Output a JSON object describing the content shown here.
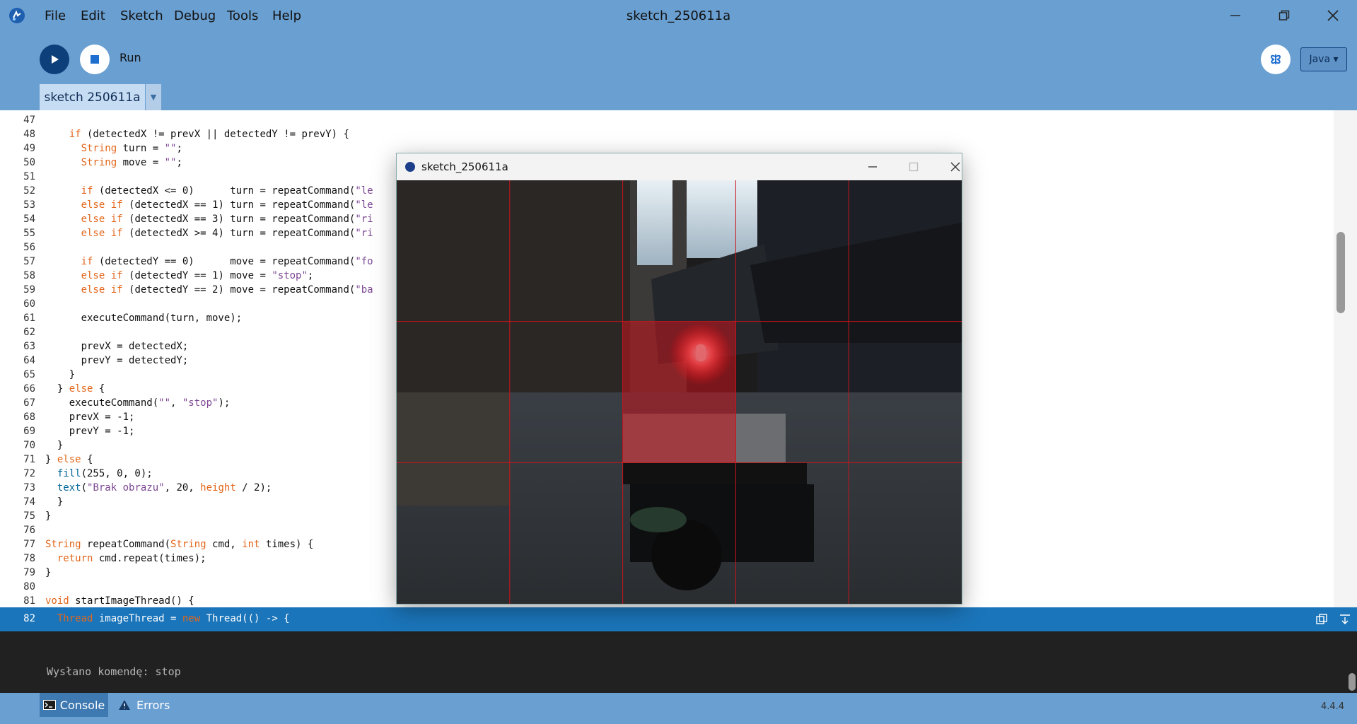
{
  "app": {
    "window_title": "sketch_250611a",
    "menu": [
      "File",
      "Edit",
      "Sketch",
      "Debug",
      "Tools",
      "Help"
    ],
    "run_label": "Run",
    "mode": "Java ▾",
    "tab_name": "sketch 250611a",
    "version": "4.4.4"
  },
  "editor": {
    "lines": [
      {
        "n": "47",
        "html": ""
      },
      {
        "n": "48",
        "html": "    <span class='kw'>if</span> (detectedX != prevX || detectedY != prevY) {"
      },
      {
        "n": "49",
        "html": "      <span class='kw'>String</span> turn = <span class='st'>\"\"</span>;"
      },
      {
        "n": "50",
        "html": "      <span class='kw'>String</span> move = <span class='st'>\"\"</span>;"
      },
      {
        "n": "51",
        "html": ""
      },
      {
        "n": "52",
        "html": "      <span class='kw'>if</span> (detectedX &lt;= 0)      turn = repeatCommand(<span class='st'>\"le</span>"
      },
      {
        "n": "53",
        "html": "      <span class='kw'>else if</span> (detectedX == 1) turn = repeatCommand(<span class='st'>\"le</span>"
      },
      {
        "n": "54",
        "html": "      <span class='kw'>else if</span> (detectedX == 3) turn = repeatCommand(<span class='st'>\"ri</span>"
      },
      {
        "n": "55",
        "html": "      <span class='kw'>else if</span> (detectedX &gt;= 4) turn = repeatCommand(<span class='st'>\"ri</span>"
      },
      {
        "n": "56",
        "html": ""
      },
      {
        "n": "57",
        "html": "      <span class='kw'>if</span> (detectedY == 0)      move = repeatCommand(<span class='st'>\"fo</span>"
      },
      {
        "n": "58",
        "html": "      <span class='kw'>else if</span> (detectedY == 1) move = <span class='st'>\"stop\"</span>;"
      },
      {
        "n": "59",
        "html": "      <span class='kw'>else if</span> (detectedY == 2) move = repeatCommand(<span class='st'>\"ba</span>"
      },
      {
        "n": "60",
        "html": ""
      },
      {
        "n": "61",
        "html": "      executeCommand(turn, move);"
      },
      {
        "n": "62",
        "html": ""
      },
      {
        "n": "63",
        "html": "      prevX = detectedX;"
      },
      {
        "n": "64",
        "html": "      prevY = detectedY;"
      },
      {
        "n": "65",
        "html": "    }"
      },
      {
        "n": "66",
        "html": "  } <span class='kw'>else</span> {"
      },
      {
        "n": "67",
        "html": "    executeCommand(<span class='st'>\"\"</span>, <span class='st'>\"stop\"</span>);"
      },
      {
        "n": "68",
        "html": "    prevX = -1;"
      },
      {
        "n": "69",
        "html": "    prevY = -1;"
      },
      {
        "n": "70",
        "html": "  }"
      },
      {
        "n": "71",
        "html": "} <span class='kw'>else</span> {"
      },
      {
        "n": "72",
        "html": "  <span class='fn'>fill</span>(255, 0, 0);"
      },
      {
        "n": "73",
        "html": "  <span class='fn'>text</span>(<span class='st'>\"Brak obrazu\"</span>, 20, <span class='kw'>height</span> / 2);"
      },
      {
        "n": "74",
        "html": "  }"
      },
      {
        "n": "75",
        "html": "}"
      },
      {
        "n": "76",
        "html": ""
      },
      {
        "n": "77",
        "html": "<span class='kw'>String</span> repeatCommand(<span class='kw'>String</span> cmd, <span class='kw'>int</span> times) {"
      },
      {
        "n": "78",
        "html": "  <span class='kw'>return</span> cmd.repeat(times);"
      },
      {
        "n": "79",
        "html": "}"
      },
      {
        "n": "80",
        "html": ""
      },
      {
        "n": "81",
        "html": "<span class='kw'>void</span> startImageThread() {"
      }
    ],
    "status_line": {
      "n": "82",
      "html": "  <span class='kw'>Thread</span> imageThread = <span class='kw'>new</span> Thread(() -&gt; {"
    }
  },
  "console": {
    "message": "Wysłano komendę: stop",
    "tabs": {
      "console": "Console",
      "errors": "Errors"
    }
  },
  "sketch_window": {
    "title": "sketch_250611a",
    "grid": {
      "cols": 5,
      "rows": 3,
      "highlight_col": 2,
      "highlight_row": 1,
      "line_color": "#c8141e",
      "highlight_color": "#c8141e"
    }
  },
  "colors": {
    "accent": "#6a9fd1",
    "run": "#0d3f7a",
    "status": "#1b75ba"
  }
}
